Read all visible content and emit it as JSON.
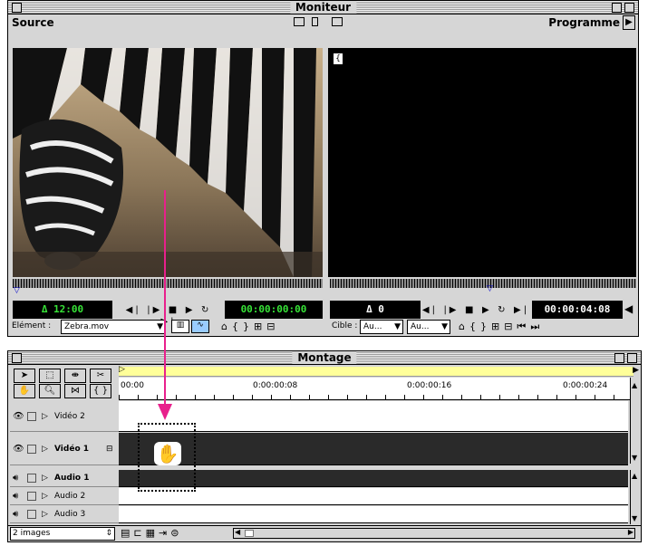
{
  "monitor": {
    "title": "Moniteur",
    "source_label": "Source",
    "program_label": "Programme",
    "source_duration": "Δ 12:00",
    "source_timecode": "00:00:00:00",
    "program_duration": "Δ 0",
    "program_timecode": "00:00:04:08",
    "element_label": "Elément :",
    "element_value": "Zebra.mov",
    "target_label": "Cible :",
    "target_video": "Au...",
    "target_audio": "Au...",
    "colors": {
      "lcd_green": "#37e337",
      "lcd_bg": "#000000"
    }
  },
  "montage": {
    "title": "Montage",
    "ruler": [
      "00:00",
      "0:00:00:08",
      "0:00:00:16",
      "0:00:00:24"
    ],
    "tracks": [
      {
        "name": "Vidéo 2",
        "bold": false
      },
      {
        "name": "Vidéo 1",
        "bold": true
      },
      {
        "name": "Audio 1",
        "bold": true
      },
      {
        "name": "Audio 2",
        "bold": false
      },
      {
        "name": "Audio 3",
        "bold": false
      }
    ],
    "status": "2 images",
    "colors": {
      "work_area": "#ffff99",
      "drag_arrow": "#e8208c"
    }
  }
}
